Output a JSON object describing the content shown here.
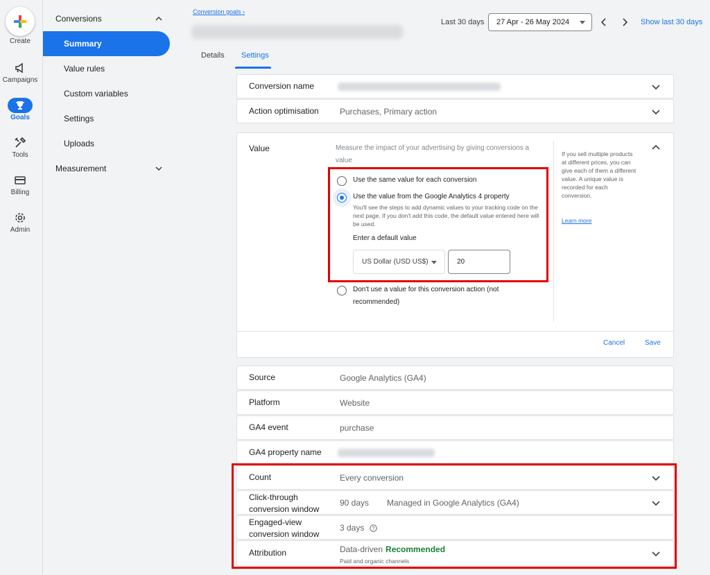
{
  "rail": {
    "create": "Create",
    "campaigns": "Campaigns",
    "goals": "Goals",
    "tools": "Tools",
    "billing": "Billing",
    "admin": "Admin"
  },
  "nav": {
    "conversions": "Conversions",
    "summary": "Summary",
    "value_rules": "Value rules",
    "custom_variables": "Custom variables",
    "settings": "Settings",
    "uploads": "Uploads",
    "measurement": "Measurement"
  },
  "header": {
    "breadcrumb": "Conversion goals",
    "date_label": "Last 30 days",
    "date_range": "27 Apr - 26 May 2024",
    "show_last": "Show last 30 days"
  },
  "tabs": [
    "Details",
    "Settings"
  ],
  "rows_top": [
    {
      "label": "Conversion name",
      "value": ""
    },
    {
      "label": "Action optimisation",
      "value": "Purchases, Primary action"
    }
  ],
  "value_card": {
    "label": "Value",
    "description": "Measure the impact of your advertising by giving conversions a value",
    "option_same": "Use the same value for each conversion",
    "option_ga4": "Use the value from the Google Analytics 4 property",
    "option_ga4_sub": "You'll see the steps to add dynamic values to your tracking code on the next page. If you don't add this code, the default value entered here will be used.",
    "default_label": "Enter a default value",
    "currency": "US Dollar (USD US$)",
    "amount": "20",
    "option_none": "Don't use a value for this conversion action (not recommended)",
    "side_help": "If you sell multiple products at different prices, you can give each of them a different value. A unique value is recorded for each conversion.",
    "learn_more": "Learn more",
    "cancel": "Cancel",
    "save": "Save"
  },
  "rows_bottom": [
    {
      "label": "Source",
      "value": "Google Analytics (GA4)"
    },
    {
      "label": "Platform",
      "value": "Website"
    },
    {
      "label": "GA4 event",
      "value": "purchase"
    },
    {
      "label": "GA4 property name",
      "value": ""
    }
  ],
  "rows_settings": {
    "count": {
      "label": "Count",
      "value": "Every conversion"
    },
    "click_through": {
      "label_line1": "Click-through",
      "label_line2": "conversion window",
      "value": "90 days",
      "extra": "Managed in Google Analytics (GA4)"
    },
    "engaged_view": {
      "label_line1": "Engaged-view",
      "label_line2": "conversion window",
      "value": "3 days"
    },
    "attribution": {
      "label": "Attribution",
      "value": "Data-driven",
      "badge": "Recommended",
      "sub": "Paid and organic channels"
    }
  },
  "colors": {
    "accent": "#1a73e8",
    "highlight": "#e00000",
    "recommended": "#188038"
  }
}
